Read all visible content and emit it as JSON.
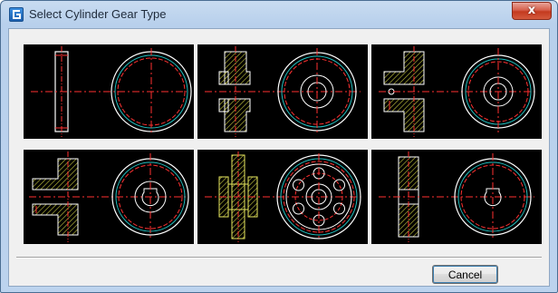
{
  "window": {
    "title": "Select Cylinder Gear Type",
    "close_glyph": "x"
  },
  "gallery": {
    "items": [
      {
        "name": "gear-type-1",
        "icon": "plain-spur-gear"
      },
      {
        "name": "gear-type-2",
        "icon": "spur-gear-with-hub-recess"
      },
      {
        "name": "gear-type-3",
        "icon": "spur-gear-with-side-hub-pin"
      },
      {
        "name": "gear-type-4",
        "icon": "spur-gear-with-side-hub-keyway"
      },
      {
        "name": "gear-type-5",
        "icon": "webbed-gear-with-holes"
      },
      {
        "name": "gear-type-6",
        "icon": "spur-gear-with-keyway"
      }
    ]
  },
  "buttons": {
    "cancel": "Cancel"
  },
  "colors": {
    "drawing_bg": "#000000",
    "centerline": "#ff2020",
    "outline": "#ffffff",
    "pitch_circle": "#20c0c0",
    "hatch": "#c8c840"
  }
}
